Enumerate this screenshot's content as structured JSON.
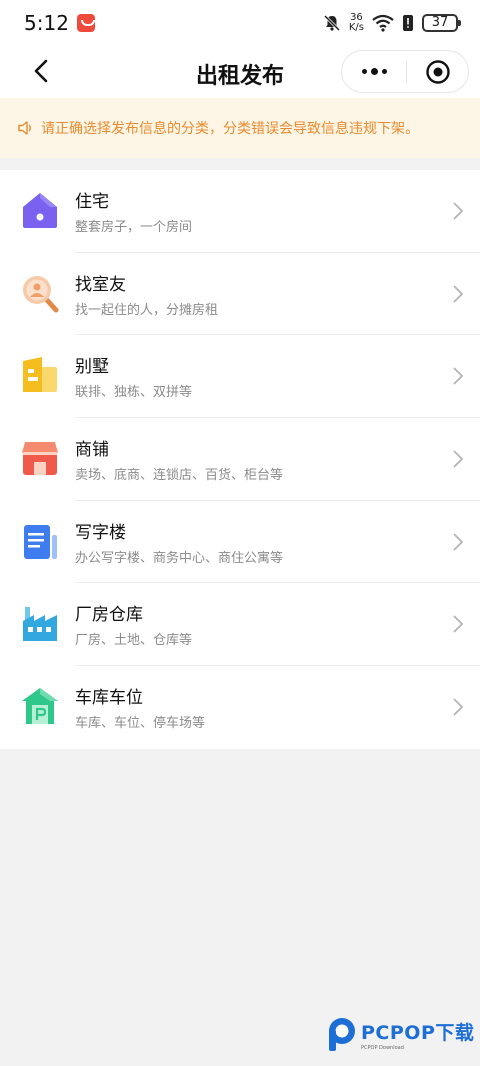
{
  "status_bar": {
    "time": "5:12",
    "net_speed_value": "36",
    "net_speed_unit": "K/s",
    "battery": "37"
  },
  "nav": {
    "title": "出租发布"
  },
  "notice": {
    "text": "请正确选择发布信息的分类，分类错误会导致信息违规下架。",
    "color": "#e98b2e"
  },
  "categories": [
    {
      "title": "住宅",
      "subtitle": "整套房子，一个房间",
      "icon": "house-icon"
    },
    {
      "title": "找室友",
      "subtitle": "找一起住的人，分摊房租",
      "icon": "find-roommate-icon"
    },
    {
      "title": "别墅",
      "subtitle": "联排、独栋、双拼等",
      "icon": "villa-icon"
    },
    {
      "title": "商铺",
      "subtitle": "卖场、底商、连锁店、百货、柜台等",
      "icon": "shop-icon"
    },
    {
      "title": "写字楼",
      "subtitle": "办公写字楼、商务中心、商住公寓等",
      "icon": "office-icon"
    },
    {
      "title": "厂房仓库",
      "subtitle": "厂房、土地、仓库等",
      "icon": "factory-icon"
    },
    {
      "title": "车库车位",
      "subtitle": "车库、车位、停车场等",
      "icon": "garage-icon"
    }
  ],
  "watermark": {
    "main": "PCPOP下载",
    "sub": "PCPOP Download"
  }
}
